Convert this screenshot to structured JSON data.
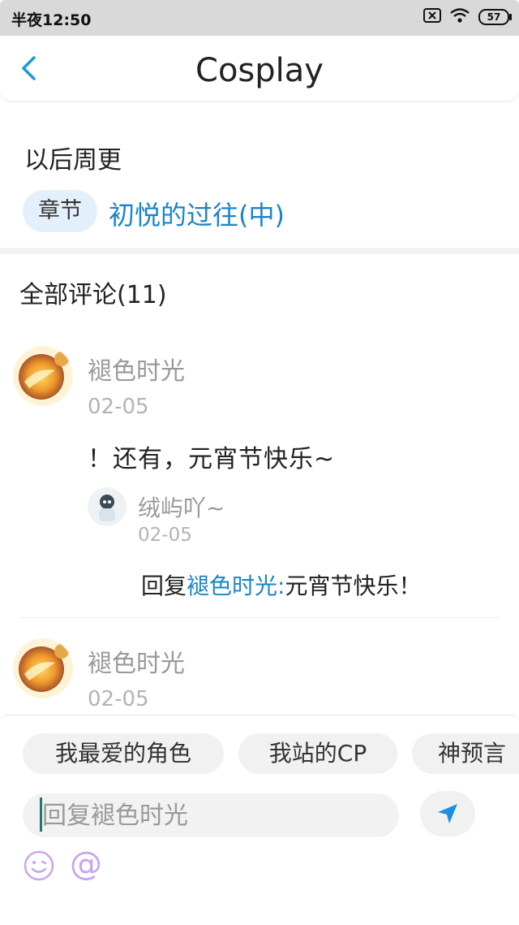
{
  "status_bar": {
    "time": "半夜12:50",
    "battery": "57"
  },
  "header": {
    "title": "Cosplay"
  },
  "work": {
    "update_note": "以后周更",
    "chapter_tag": "章节",
    "chapter_title": "初悦的过往(中)"
  },
  "comments": {
    "header": "全部评论(11)",
    "items": [
      {
        "author": "褪色时光",
        "date": "02-05",
        "text": "！还有，元宵节快乐~",
        "reply": {
          "author": "绒屿吖~",
          "date": "02-05",
          "prefix": "回复",
          "mention": "褪色时光:",
          "text": "元宵节快乐！"
        }
      },
      {
        "author": "褪色时光",
        "date": "02-05"
      }
    ]
  },
  "composer": {
    "topics": [
      "我最爱的角色",
      "我站的CP",
      "神预言"
    ],
    "placeholder": "回复褪色时光"
  },
  "colors": {
    "accent": "#1b84c8",
    "tag_bg": "#e3f0fb",
    "emoji_purple": "#c9a6ec"
  }
}
